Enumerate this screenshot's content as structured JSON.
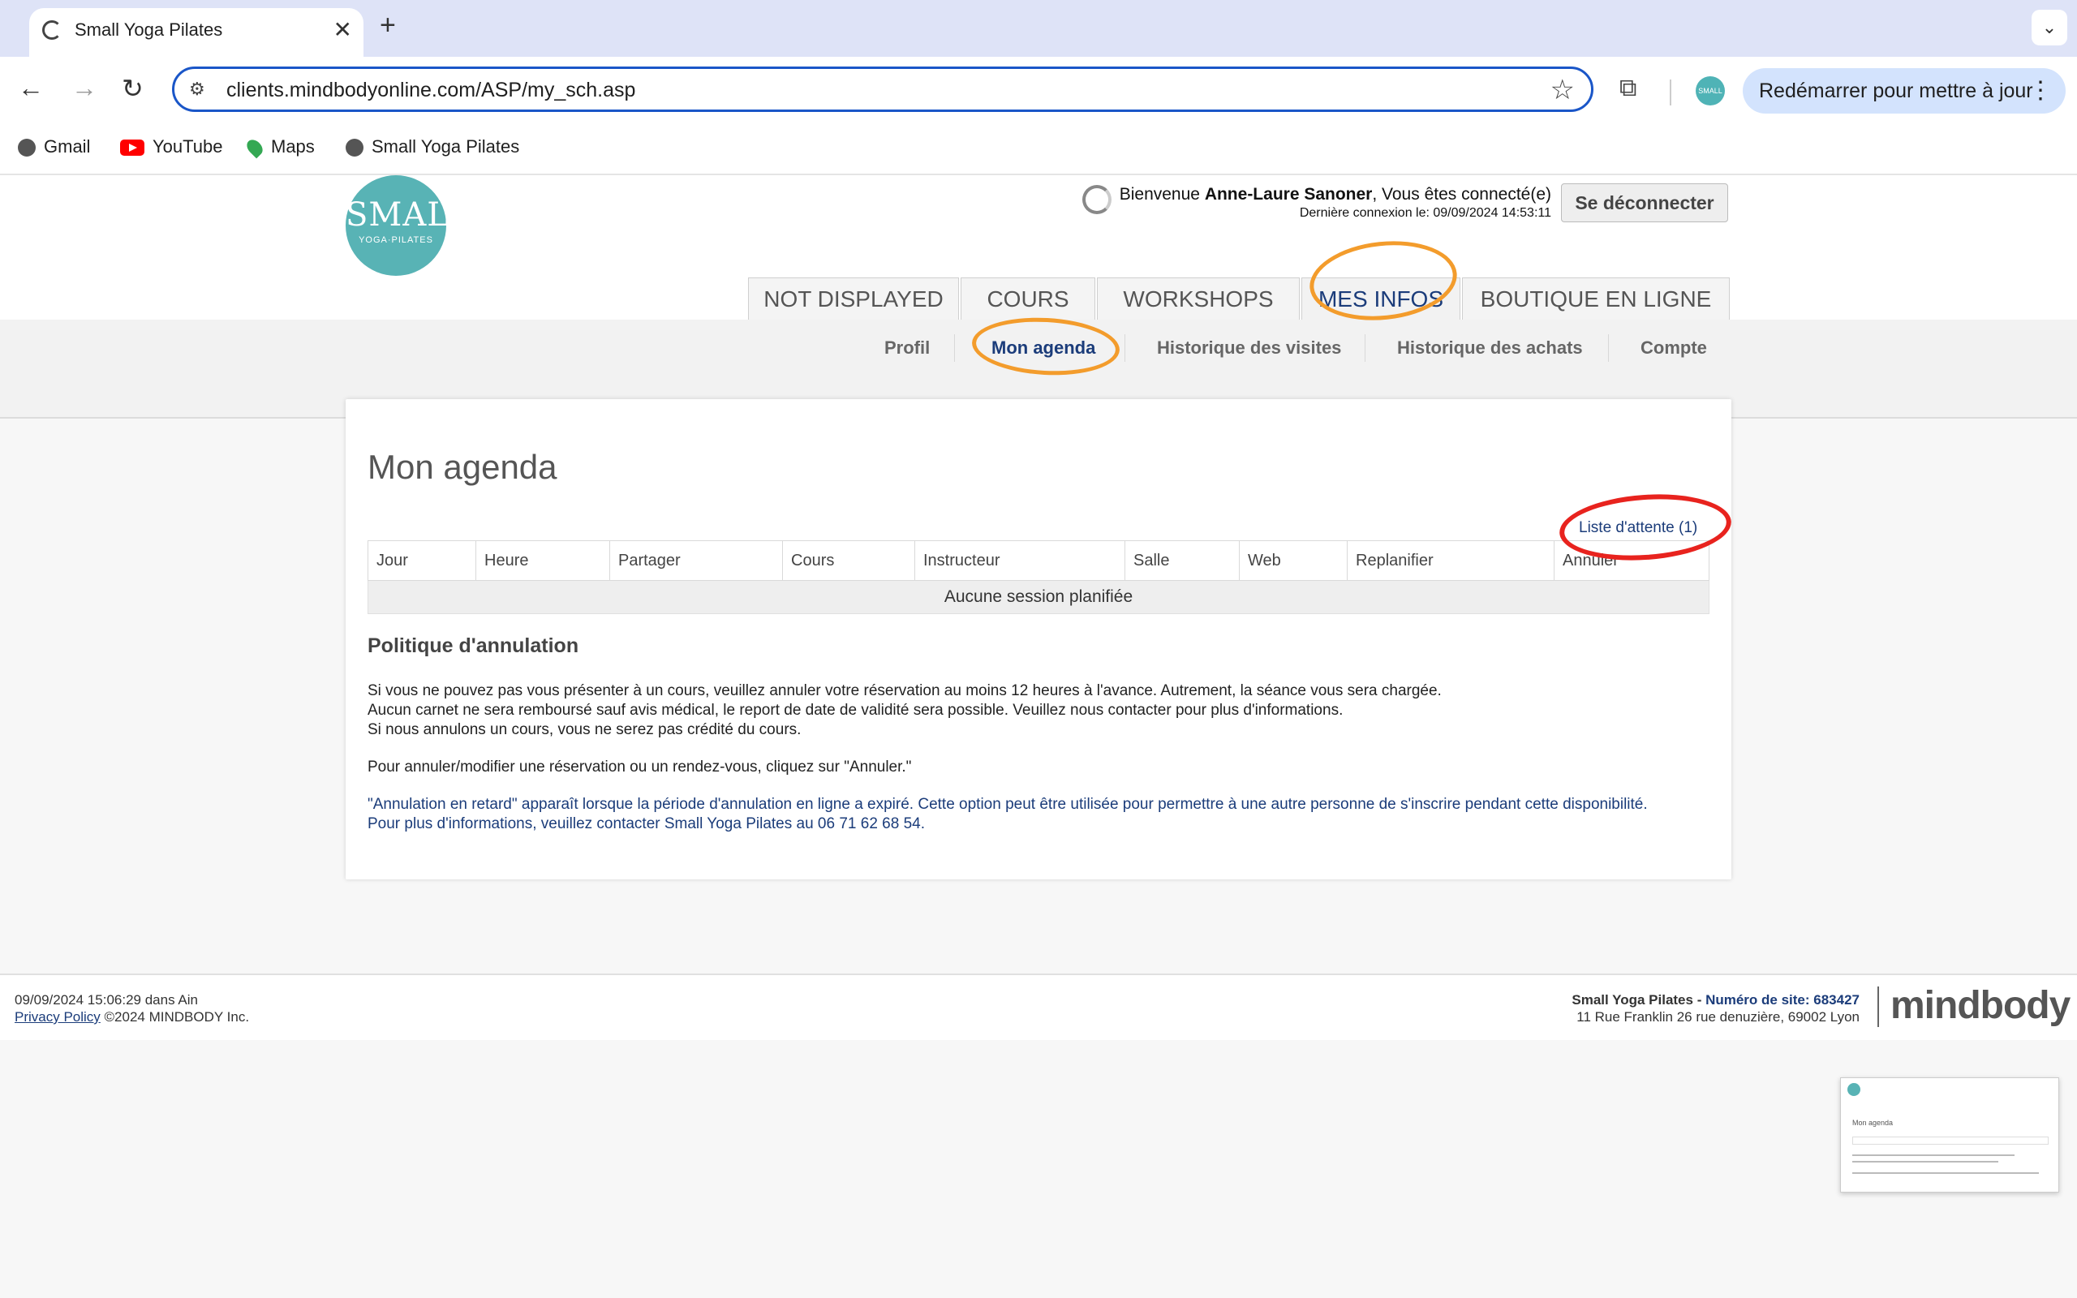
{
  "browser": {
    "tab_title": "Small Yoga Pilates",
    "url": "clients.mindbodyonline.com/ASP/my_sch.asp",
    "update_button": "Redémarrer pour mettre à jour",
    "profile_label": "SMALL",
    "bookmarks": [
      "Gmail",
      "YouTube",
      "Maps",
      "Small Yoga Pilates"
    ]
  },
  "header": {
    "logo_big": "SMALL",
    "logo_small": "YOGA·PILATES",
    "welcome_prefix": "Bienvenue ",
    "user_name": "Anne-Laure Sanoner",
    "welcome_suffix": ", Vous êtes connecté(e)",
    "last_login": "Dernière connexion le: 09/09/2024 14:53:11",
    "logout_label": "Se déconnecter",
    "main_tabs": [
      "NOT DISPLAYED",
      "COURS",
      "WORKSHOPS",
      "MES INFOS",
      "BOUTIQUE EN LIGNE"
    ],
    "active_tab": "MES INFOS"
  },
  "subnav": {
    "items": [
      "Profil",
      "Mon agenda",
      "Historique des visites",
      "Historique des achats",
      "Compte"
    ],
    "active": "Mon agenda"
  },
  "main": {
    "title": "Mon agenda",
    "waitlist_link": "Liste d'attente (1)",
    "columns": [
      "Jour",
      "Heure",
      "Partager",
      "Cours",
      "Instructeur",
      "Salle",
      "Web",
      "Replanifier",
      "Annuler"
    ],
    "empty_message": "Aucune session planifiée",
    "policy_title": "Politique d'annulation",
    "policy_lines": [
      "Si vous ne pouvez pas vous présenter à un cours, veuillez annuler votre réservation au moins 12 heures à l'avance. Autrement, la séance vous sera chargée.",
      "Aucun carnet ne sera remboursé sauf avis médical, le report de date de validité sera possible. Veuillez nous contacter pour plus d'informations.",
      "Si nous annulons un cours, vous ne serez pas crédité du cours."
    ],
    "cancel_instruction": "Pour annuler/modifier une réservation ou un rendez-vous, cliquez sur \"Annuler.\"",
    "late_cancel_lines": [
      "\"Annulation en retard\" apparaît lorsque la période d'annulation en ligne a expiré. Cette option peut être utilisée pour permettre à une autre personne de s'inscrire pendant cette disponibilité.",
      "Pour plus d'informations, veuillez contacter Small Yoga Pilates au 06 71 62 68 54."
    ]
  },
  "footer": {
    "datetime": "09/09/2024 15:06:29 dans Ain",
    "privacy_link": "Privacy Policy",
    "copyright": " ©2024 MINDBODY Inc.",
    "studio_name": "Small Yoga Pilates - ",
    "site_number": "Numéro de site: 683427",
    "address": "11 Rue Franklin 26 rue denuzière, 69002 Lyon",
    "brand": "mindbody"
  },
  "colors": {
    "accent_blue": "#1b3c7a",
    "logo_teal": "#58b3b5",
    "annotation_orange": "#f39c2c",
    "annotation_red": "#e8231e"
  }
}
